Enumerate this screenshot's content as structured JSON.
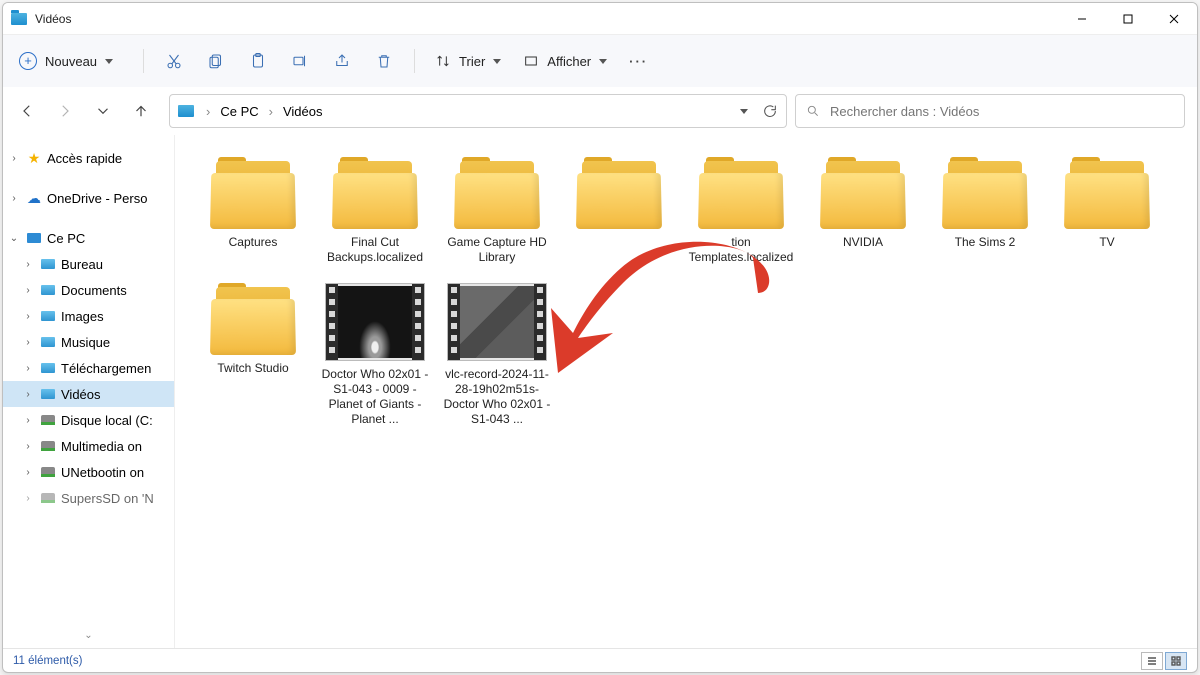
{
  "window": {
    "title": "Vidéos"
  },
  "cmdbar": {
    "new_label": "Nouveau",
    "sort_label": "Trier",
    "view_label": "Afficher"
  },
  "breadcrumb": {
    "root": "Ce PC",
    "current": "Vidéos"
  },
  "search": {
    "placeholder": "Rechercher dans : Vidéos"
  },
  "sidebar": {
    "quick": "Accès rapide",
    "onedrive": "OneDrive - Perso",
    "pc": "Ce PC",
    "items": [
      "Bureau",
      "Documents",
      "Images",
      "Musique",
      "Téléchargemen",
      "Vidéos",
      "Disque local (C:",
      "Multimedia on",
      "UNetbootin on",
      "SupersSD on 'N"
    ]
  },
  "folders": [
    "Captures",
    "Final Cut Backups.localized",
    "Game Capture HD Library",
    "",
    "tion Templates.localized",
    "NVIDIA",
    "The Sims 2",
    "TV",
    "Twitch Studio"
  ],
  "videos": [
    "Doctor Who 02x01 - S1-043 - 0009 - Planet of Giants - Planet ...",
    "vlc-record-2024-11-28-19h02m51s-Doctor Who 02x01 - S1-043 ..."
  ],
  "status": {
    "count": "11 élément(s)"
  }
}
